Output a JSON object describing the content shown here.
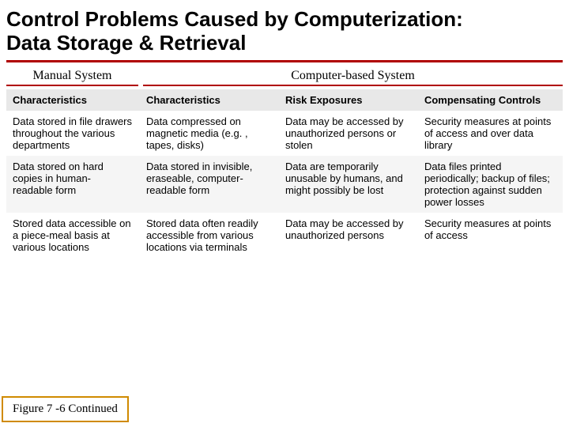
{
  "title_line1": "Control Problems Caused by Computerization:",
  "title_line2": "Data Storage & Retrieval",
  "group_labels": {
    "manual": "Manual System",
    "computer": "Computer-based System"
  },
  "columns": [
    "Characteristics",
    "Characteristics",
    "Risk Exposures",
    "Compensating Controls"
  ],
  "rows": [
    {
      "c0": "Data stored in file drawers throughout the various departments",
      "c1": "Data compressed on magnetic media (e.g. , tapes, disks)",
      "c2": "Data may be accessed by unauthorized persons or stolen",
      "c3": "Security measures at points of access and over data library"
    },
    {
      "c0": "Data stored on hard copies in human- readable form",
      "c1": "Data stored in invisible, eraseable, computer-readable form",
      "c2": "Data are temporarily unusable by humans, and might possibly be lost",
      "c3": "Data files printed periodically; backup of files; protection against sudden power losses"
    },
    {
      "c0": "Stored data accessible on a piece-meal basis at various locations",
      "c1": "Stored data often readily accessible from various locations via terminals",
      "c2": "Data may be accessed by unauthorized persons",
      "c3": "Security measures at points of access"
    }
  ],
  "figure_label": "Figure 7 -6 Continued"
}
